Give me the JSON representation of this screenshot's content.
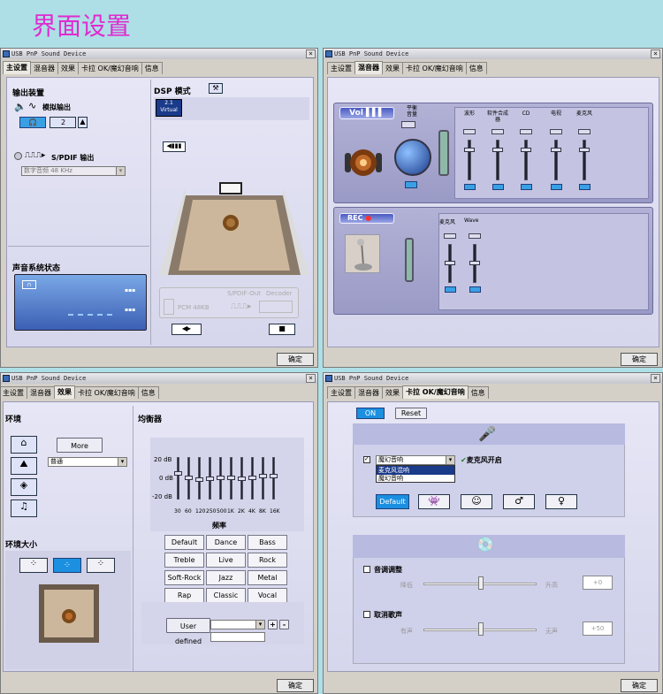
{
  "page_title": "界面设置",
  "window_title": "USB PnP Sound Device",
  "tabs": [
    "主设置",
    "混音器",
    "效果",
    "卡拉 OK/魔幻音响",
    "信息"
  ],
  "ok_label": "确定",
  "win1": {
    "output_device": "输出装置",
    "analog_output": "模拟输出",
    "analog_badge": "2",
    "spdif_output": "S/PDIF 输出",
    "spdif_select": "数字音频 48 KHz",
    "speaker_status": "声音系统状态",
    "dsp_mode": "DSP 模式",
    "dsp_box_line1": "2.1",
    "dsp_box_line2": "Virtual",
    "spdif_out_label": "S/PDIF-Out",
    "decoder_label": "Decoder",
    "pcm_label": "PCM 48KB"
  },
  "win2": {
    "vol_label": "Vol ▌▌▌",
    "balance_label": "平衡\n音量",
    "playback_channels": [
      "波形",
      "软件合成器",
      "CD",
      "电视",
      "麦克风"
    ],
    "rec_label": "REC",
    "rec_channels": [
      "麦克风",
      "Wave"
    ]
  },
  "win3": {
    "environment": "环境",
    "more_options": "More options",
    "env_select": "普通",
    "env_size": "环境大小",
    "equalizer": "均衡器",
    "db_labels": [
      "20 dB",
      "0 dB",
      "-20 dB"
    ],
    "freqs": [
      "30",
      "60",
      "120",
      "250",
      "500",
      "1K",
      "2K",
      "4K",
      "8K",
      "16K"
    ],
    "eq_levels": [
      0.38,
      0.5,
      0.55,
      0.52,
      0.5,
      0.5,
      0.52,
      0.5,
      0.46,
      0.45
    ],
    "freq_title": "频率",
    "presets": [
      "Default",
      "Dance",
      "Bass",
      "Treble",
      "Live",
      "Rock",
      "Soft-Rock",
      "Jazz",
      "Metal",
      "Rap",
      "Classic",
      "Vocal"
    ],
    "user_defined": "User defined",
    "plus": "+",
    "minus": "-"
  },
  "win4": {
    "on": "ON",
    "reset": "Reset",
    "mic_select": "魔幻音响",
    "mic_on": "麦克风开启",
    "mic_options": [
      "麦克风混响",
      "魔幻音响"
    ],
    "default_btn": "Default",
    "pitch_adjust": "音调调整",
    "pitch_low": "降低",
    "pitch_high": "升高",
    "pitch_value": "+0",
    "vocal_cancel": "取消歌声",
    "vocal_with": "有声",
    "vocal_without": "无声",
    "vocal_value": "+50"
  }
}
